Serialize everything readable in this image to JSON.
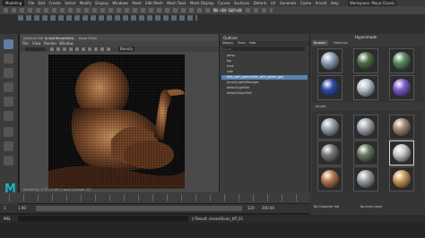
{
  "menubar": {
    "workspace": "Modeling",
    "items": [
      "File",
      "Edit",
      "Create",
      "Select",
      "Modify",
      "Display",
      "Windows",
      "Mesh",
      "Edit Mesh",
      "Mesh Tools",
      "Mesh Display",
      "Curves",
      "Surfaces",
      "Deform",
      "UV",
      "Generate",
      "Cache",
      "Arnold",
      "Help"
    ],
    "workspace_right": "Workspace: Maya Classic"
  },
  "statusline": {
    "no_live_surface": "No Live Surface"
  },
  "render_view": {
    "tabs": [
      "Attribute Editor",
      "Arnold RenderView",
      "Mode Editor"
    ],
    "active_tab": "Arnold RenderView",
    "menus": [
      "File",
      "View",
      "Render",
      "Window"
    ],
    "camera": "Beauty",
    "status": "Rendering | 0.35 x 0.40 | 1 pass | sample: 3/3"
  },
  "outliner": {
    "title": "Outliner",
    "menus": [
      "Display",
      "Show",
      "Help"
    ],
    "search_placeholder": "Search...",
    "items": [
      "persp",
      "top",
      "front",
      "side",
      "Kids_with_goose:Kids_with_goose_geo",
      "Arnold_lightsManager",
      "defaultLightSet",
      "defaultObjectSet"
    ],
    "selected_index": 4
  },
  "hypershade": {
    "title": "Hypershade",
    "tabs": [
      "Browser",
      "Materials"
    ],
    "section_label": "Arnold",
    "material_colors": [
      "#8ea0b6",
      "#4e6e44",
      "#5a8a5e",
      "#2e4aa6",
      "#b9c2cc",
      "#7a5ccc",
      "#9aa2ad",
      "#a0a8b0",
      "#a08a70",
      "#7a7a7a",
      "#6a7a62",
      "#c8c8c8",
      "#b87850",
      "#9aa0a8",
      "#c89a58",
      "#b0c0cc",
      "#c8c8c8",
      "#8896a0"
    ]
  },
  "timeline": {
    "start": "1",
    "end": "120",
    "range_start": "1.00",
    "range_end": "200.00",
    "no_character_set": "No Character Set",
    "no_anim_layer": "No Anim Layer"
  },
  "cmdline": {
    "mode": "MEL",
    "result": "// Result: closestScan_tiff_01"
  }
}
